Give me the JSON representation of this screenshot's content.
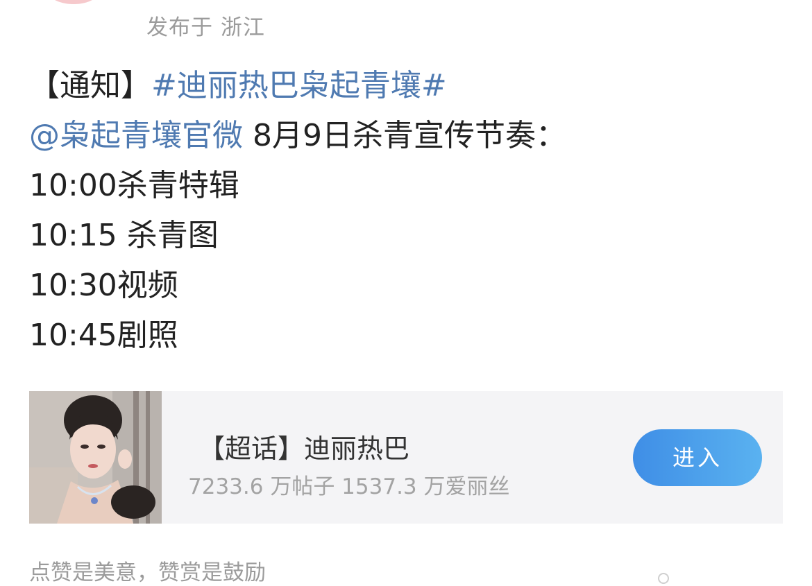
{
  "header": {
    "location": "发布于 浙江"
  },
  "post": {
    "notice_prefix": "【通知】",
    "topic": "#迪丽热巴枭起青壤#",
    "mention": "@枭起青壤官微",
    "intro_text": " 8月9日杀青宣传节奏：",
    "schedule": [
      {
        "text": "10:00杀青特辑"
      },
      {
        "text": "10:15 杀青图"
      },
      {
        "text": "10:30视频"
      },
      {
        "text": "10:45剧照"
      }
    ]
  },
  "supertopic_card": {
    "title": "【超话】迪丽热巴",
    "stats": "7233.6 万帖子 1537.3 万爱丽丝",
    "button_label": "进入",
    "button_color": "#4a9eea"
  },
  "footer": {
    "note": "点赞是美意，赞赏是鼓励"
  },
  "colors": {
    "link": "#4f7ab1",
    "muted": "#9b9b9b",
    "card_bg": "#f4f4f6"
  }
}
